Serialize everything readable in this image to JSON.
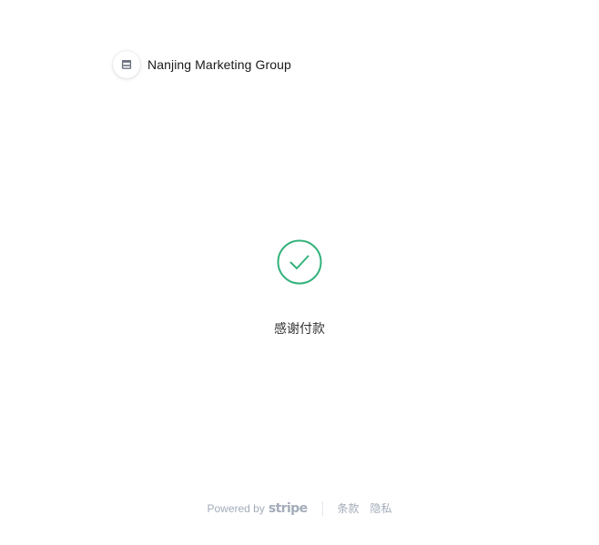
{
  "header": {
    "merchant_name": "Nanjing Marketing Group",
    "merchant_icon": "store-icon"
  },
  "success": {
    "icon": "checkmark-circle-icon",
    "accent_color": "#33b27b",
    "message": "感谢付款"
  },
  "footer": {
    "powered_by": "Powered by",
    "brand": "stripe",
    "terms_link": "条款",
    "privacy_link": "隐私",
    "text_color": "#a3acb9"
  }
}
